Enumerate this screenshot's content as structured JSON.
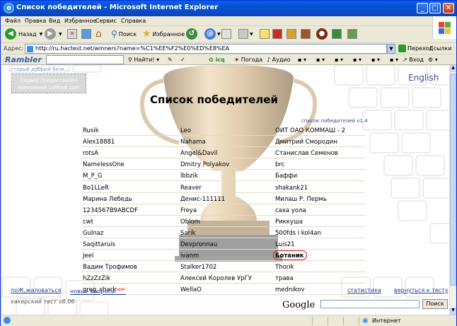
{
  "window": {
    "title": "Список победителей - Microsoft Internet Explorer",
    "ie_icon_glyph": "e"
  },
  "menu": [
    "Файл",
    "Правка",
    "Вид",
    "Избранное",
    "Сервис",
    "Справка"
  ],
  "toolbar": {
    "back": "Назад",
    "search": "Поиск",
    "favorites": "Избранное"
  },
  "address": {
    "label": "Адрес:",
    "url": "http://ru.hactest.net/winners?name=%C1%EE%F2%E0%ED%E8%EA",
    "go": "Переход",
    "links": "Ссылки"
  },
  "rambler": {
    "logo": "Rambler",
    "find": "Найти!",
    "icq": "icq",
    "weather": "Погода",
    "audio": "Аудио",
    "login": "Вход"
  },
  "page": {
    "top_link": "старый добрый бочк...",
    "ad_text": "Сервер предоставлен компанией Lolihost.com",
    "english": "English",
    "title": "Список победителей",
    "version": "список победителей v1.4",
    "winners": [
      [
        "Rusik",
        "Leo",
        "ОИТ ОАО КОММАШ - 2"
      ],
      [
        "Alex18881",
        "Nahama",
        "Дмитрий Смородин"
      ],
      [
        "rotsA",
        "Angel&Davil",
        "Станислав Семенов"
      ],
      [
        "NamelessOne",
        "Dmitry Polyakov",
        "brc"
      ],
      [
        "M_P_G",
        "lbbzik",
        "Баффи"
      ],
      [
        "Bo1LLeR",
        "Reaver",
        "shakank21"
      ],
      [
        "Марина Лебедь",
        "Денис-111111",
        "Милаш Р. Пермь"
      ],
      [
        "1234567В9ABCDF",
        "Freya",
        "саха уола"
      ],
      [
        "cwt",
        "Oblom",
        "Риккушa"
      ],
      [
        "Gulnaz",
        "Sarik",
        "500fds i kol4an"
      ],
      [
        "Saqittaruis",
        "Devpronnau",
        "Luis21"
      ],
      [
        "Jeel",
        "ivanm",
        "Ботаник"
      ],
      [
        "Вадим Трофимов",
        "Stalker1702",
        "Thorik"
      ],
      [
        "hZzZzZik",
        "Алексей Королев УрГУ",
        "трава"
      ],
      [
        "greg_shark",
        "WellaO",
        "mednikov"
      ]
    ],
    "links": {
      "complain": "поЖ,жаловаться",
      "new_questions": "новые вопросы",
      "new_tag": "new!",
      "stats": "статистика",
      "back_to_test": "вернуться к тесту"
    },
    "footer_version": "хакерский тест v8.06",
    "google_logo": "Google",
    "google_button": "Поиск"
  },
  "status": {
    "zone": "Интернет"
  },
  "colors": {
    "title_blue": "#0a49c7",
    "link": "#1f3c9a",
    "highlight_red": "#d0181e",
    "row_line": "#e6d9c0"
  }
}
